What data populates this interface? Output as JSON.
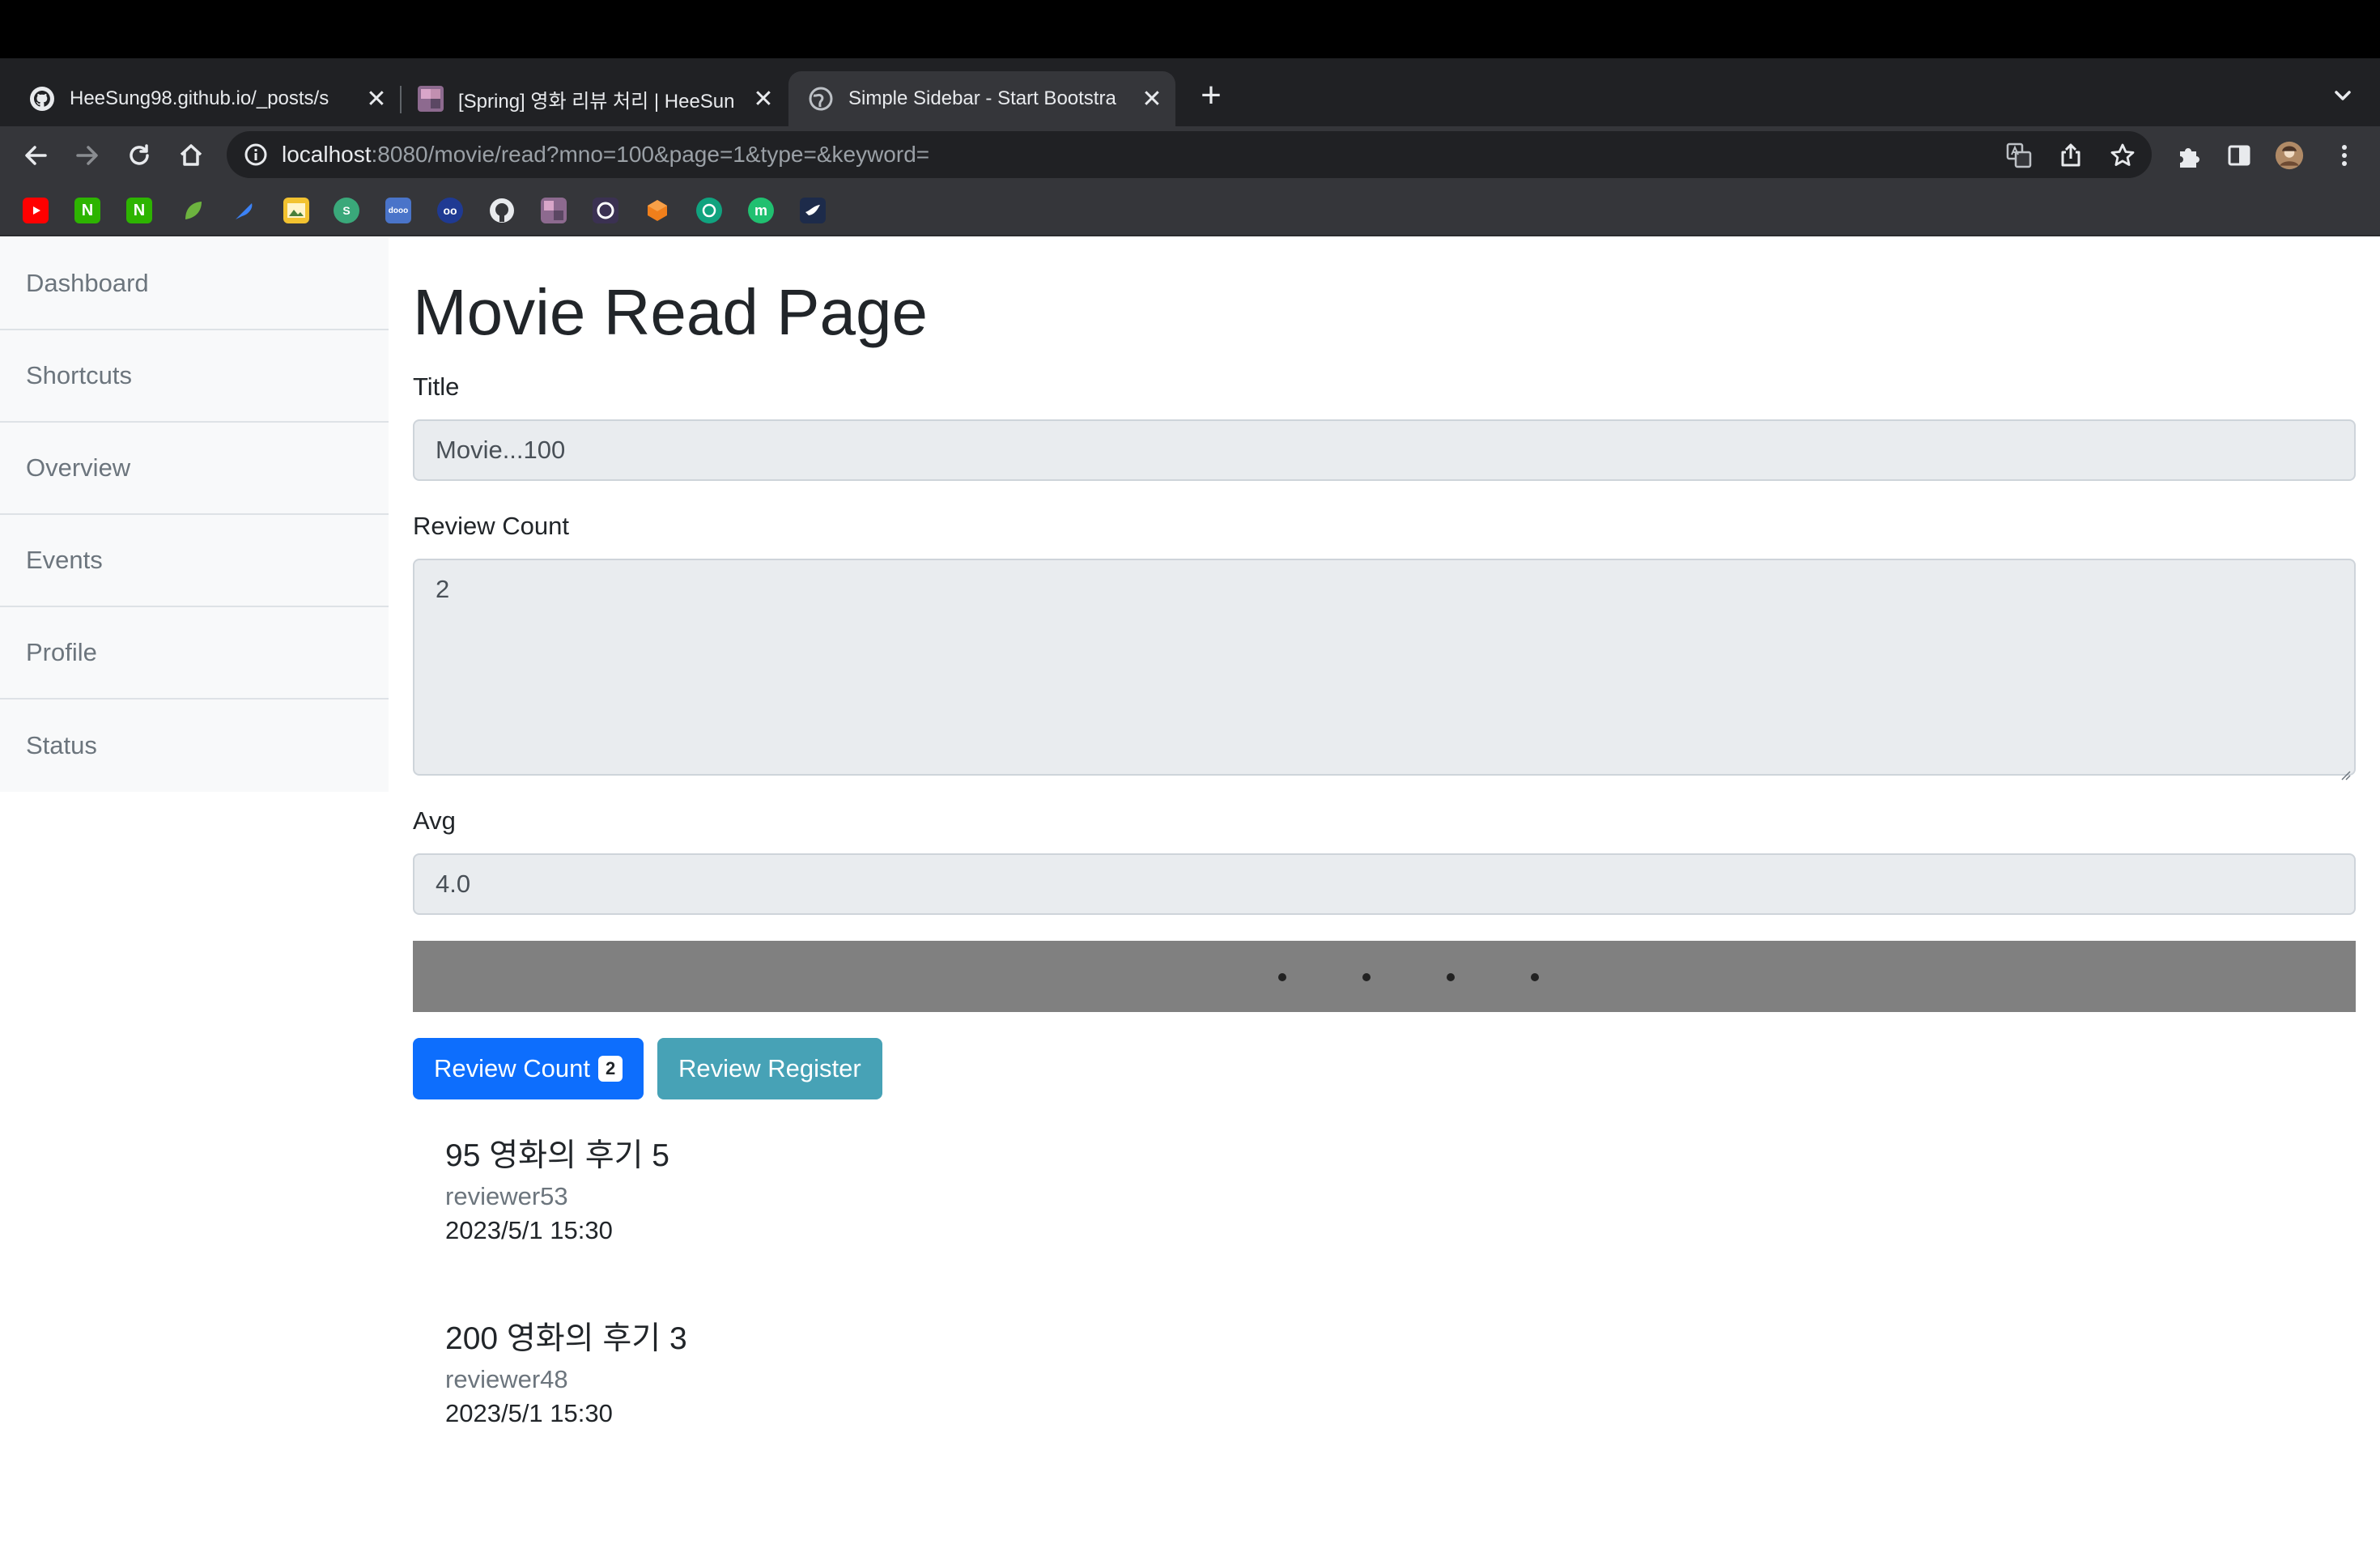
{
  "browser": {
    "tabs": [
      {
        "title": "HeeSung98.github.io/_posts/s",
        "favicon": "github-icon",
        "active": false
      },
      {
        "title": "[Spring] 영화 리뷰 처리 | HeeSun",
        "favicon": "blog-avatar-icon",
        "active": false
      },
      {
        "title": "Simple Sidebar - Start Bootstra",
        "favicon": "globe-icon",
        "active": true
      }
    ],
    "url_host": "localhost",
    "url_rest": ":8080/movie/read?mno=100&page=1&type=&keyword=",
    "bookmarks": [
      "youtube-icon",
      "naver-icon",
      "naver-icon",
      "leaf-icon",
      "feather-icon",
      "image-icon",
      "circle-app-icon",
      "dooray-icon",
      "papago-icon",
      "github-icon",
      "blog-avatar-icon",
      "app-icon",
      "orange-cube-icon",
      "openai-icon",
      "m-icon",
      "bird-icon"
    ]
  },
  "sidebar": {
    "items": [
      {
        "label": "Dashboard"
      },
      {
        "label": "Shortcuts"
      },
      {
        "label": "Overview"
      },
      {
        "label": "Events"
      },
      {
        "label": "Profile"
      },
      {
        "label": "Status"
      }
    ]
  },
  "page": {
    "title": "Movie Read Page",
    "fields": {
      "title_label": "Title",
      "title_value": "Movie...100",
      "review_count_label": "Review Count",
      "review_count_value": "2",
      "avg_label": "Avg",
      "avg_value": "4.0"
    },
    "buttons": {
      "review_count_label": "Review Count",
      "review_count_badge": "2",
      "review_register_label": "Review Register"
    },
    "reviews": [
      {
        "title": "95 영화의 후기 5",
        "reviewer": "reviewer53",
        "date": "2023/5/1 15:30"
      },
      {
        "title": "200 영화의 후기 3",
        "reviewer": "reviewer48",
        "date": "2023/5/1 15:30"
      }
    ]
  },
  "colors": {
    "primary": "#0d6efd",
    "info": "#47a2b6",
    "carousel_bg": "#808080",
    "field_bg": "#e9ecef"
  }
}
